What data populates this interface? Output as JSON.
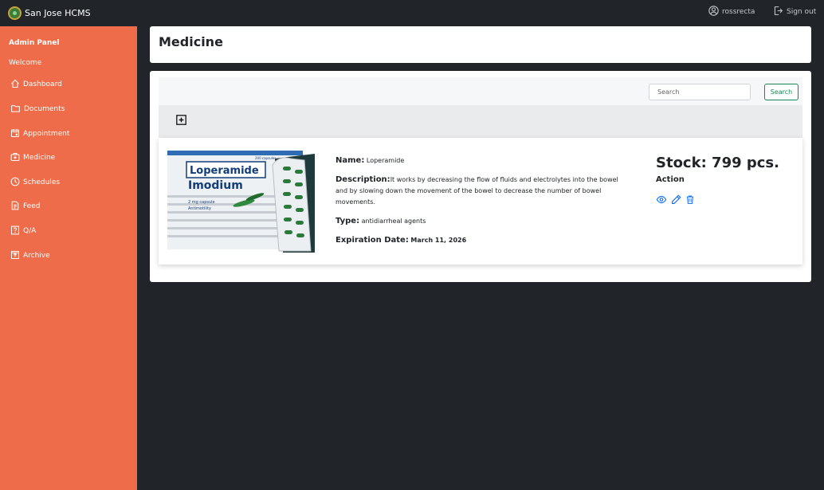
{
  "app": {
    "title": "San Jose HCMS"
  },
  "topbar": {
    "username": "rossrecta",
    "signout_label": "Sign out"
  },
  "sidebar": {
    "title": "Admin Panel",
    "welcome": "Welcome",
    "items": [
      {
        "label": "Dashboard",
        "icon": "home-icon"
      },
      {
        "label": "Documents",
        "icon": "folder-icon"
      },
      {
        "label": "Appointment",
        "icon": "calendar-icon"
      },
      {
        "label": "Medicine",
        "icon": "medkit-icon"
      },
      {
        "label": "Schedules",
        "icon": "clock-icon"
      },
      {
        "label": "Feed",
        "icon": "file-text-icon"
      },
      {
        "label": "Q/A",
        "icon": "question-icon"
      },
      {
        "label": "Archive",
        "icon": "archive-icon"
      }
    ]
  },
  "page": {
    "title": "Medicine"
  },
  "search": {
    "placeholder": "Search",
    "button_label": "Search"
  },
  "medicine": {
    "name_label": "Name:",
    "name": "Loperamide",
    "description_label": "Description:",
    "description": "It works by decreasing the flow of fluids and electrolytes into the bowel and by slowing down the movement of the bowel to decrease the number of bowel movements.",
    "type_label": "Type:",
    "type": "antidiarrheal agents",
    "expiration_label": "Expiration Date:",
    "expiration": "March 11, 2026",
    "stock": "Stock: 799 pcs.",
    "action_label": "Action",
    "image_text": {
      "brand": "Loperamide",
      "sub": "Imodium",
      "capsules": "200 capsules",
      "dose": "2 mg capsule",
      "category": "Antimotility"
    }
  },
  "colors": {
    "sidebar": "#ee6c4a",
    "topbar": "#212529",
    "accent_blue": "#0d6efd",
    "search_green": "#198754"
  }
}
